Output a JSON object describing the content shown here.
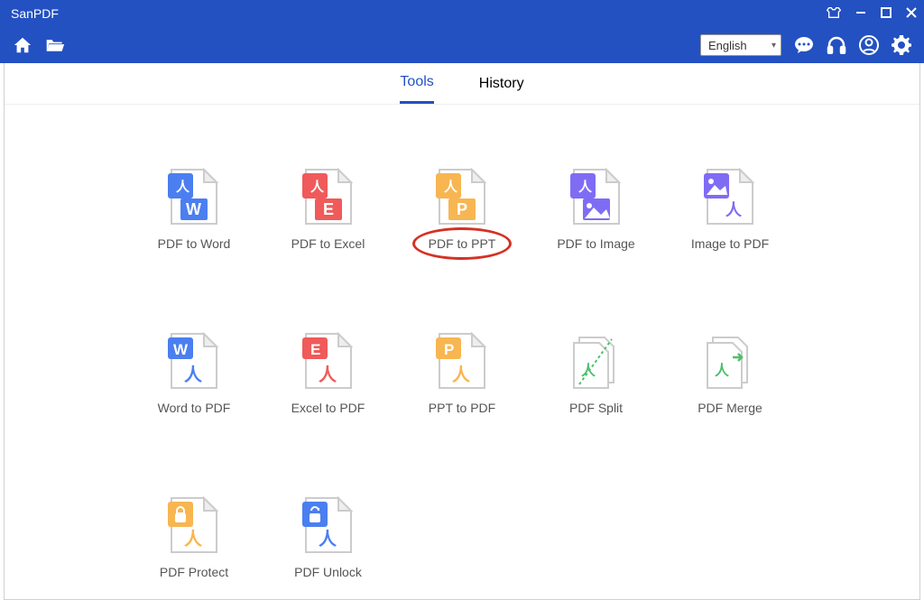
{
  "app": {
    "title": "SanPDF"
  },
  "lang": {
    "selected": "English"
  },
  "tabs": {
    "tools": "Tools",
    "history": "History",
    "active": "tools"
  },
  "tools": [
    {
      "id": "pdf-to-word",
      "label": "PDF to Word"
    },
    {
      "id": "pdf-to-excel",
      "label": "PDF to Excel"
    },
    {
      "id": "pdf-to-ppt",
      "label": "PDF to PPT",
      "highlighted": true
    },
    {
      "id": "pdf-to-image",
      "label": "PDF to Image"
    },
    {
      "id": "image-to-pdf",
      "label": "Image to PDF"
    },
    {
      "id": "word-to-pdf",
      "label": "Word to PDF"
    },
    {
      "id": "excel-to-pdf",
      "label": "Excel to PDF"
    },
    {
      "id": "ppt-to-pdf",
      "label": "PPT to PDF"
    },
    {
      "id": "pdf-split",
      "label": "PDF Split"
    },
    {
      "id": "pdf-merge",
      "label": "PDF Merge"
    },
    {
      "id": "pdf-protect",
      "label": "PDF Protect"
    },
    {
      "id": "pdf-unlock",
      "label": "PDF Unlock"
    }
  ]
}
